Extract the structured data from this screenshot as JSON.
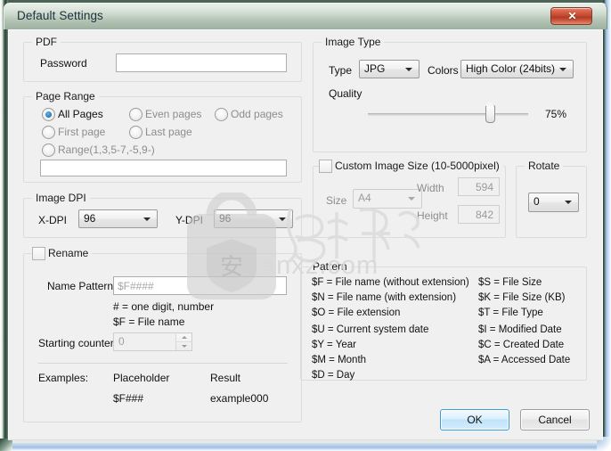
{
  "window": {
    "title": "Default Settings",
    "close_label": "✕",
    "close_icon": "close-icon"
  },
  "pdf_group": {
    "legend": "PDF",
    "password_label": "Password",
    "password_value": "",
    "password_placeholder": ""
  },
  "page_range_group": {
    "legend": "Page Range",
    "options": [
      {
        "label": "All Pages",
        "checked": true
      },
      {
        "label": "Even pages",
        "checked": false
      },
      {
        "label": "Odd pages",
        "checked": false
      },
      {
        "label": "First page",
        "checked": false
      },
      {
        "label": "Last page",
        "checked": false
      },
      {
        "label": "Range(1,3,5-7,-5,9-)",
        "checked": false
      }
    ],
    "range_value": "",
    "range_placeholder": ""
  },
  "image_dpi_group": {
    "legend": "Image DPI",
    "x_dpi_label": "X-DPI",
    "x_dpi_value": "96",
    "y_dpi_label": "Y-DPI",
    "y_dpi_value": "96"
  },
  "rename_group": {
    "legend": "Rename",
    "checked": false,
    "name_pattern_label": "Name Pattern",
    "name_pattern_value": "$F####",
    "hint_digit": "# = one digit, number",
    "hint_filename": "$F = File name",
    "starting_counter_label": "Starting counter",
    "starting_counter_value": "0",
    "examples_label": "Examples:",
    "placeholder_header": "Placeholder",
    "result_header": "Result",
    "example_placeholder": "$F###",
    "example_result": "example000"
  },
  "image_type_group": {
    "legend": "Image Type",
    "type_label": "Type",
    "type_value": "JPG",
    "colors_label": "Colors",
    "colors_value": "High Color (24bits)",
    "quality_label": "Quality",
    "quality_percent": "75%",
    "quality_value": 75
  },
  "custom_size_group": {
    "legend": "Custom Image Size (10-5000pixel)",
    "checked": false,
    "size_label": "Size",
    "size_value": "A4",
    "width_label": "Width",
    "width_value": "594",
    "height_label": "Height",
    "height_value": "842"
  },
  "rotate_group": {
    "legend": "Rotate",
    "value": "0"
  },
  "pattern_group": {
    "legend": "Pattern",
    "left_column": [
      "$F = File name (without extension)",
      "$N = File name (with extension)",
      "$O = File extension",
      "$U = Current system date",
      "$Y = Year",
      "$M = Month",
      "$D = Day"
    ],
    "right_column": [
      "$S = File Size",
      "$K = File Size (KB)",
      "$T = File Type",
      "$I = Modified Date",
      "$C = Created Date",
      "$A = Accessed Date"
    ]
  },
  "buttons": {
    "ok_label": "OK",
    "cancel_label": "Cancel"
  },
  "watermark": {
    "domain": "anxz.com",
    "glyph": "安"
  },
  "colors": {
    "accent": "#3c9fd4",
    "close_red": "#c54b32",
    "radio_blue": "#2e7fc0",
    "dialog_bg": "#f0f0f0",
    "group_border": "#dcdcdc"
  }
}
